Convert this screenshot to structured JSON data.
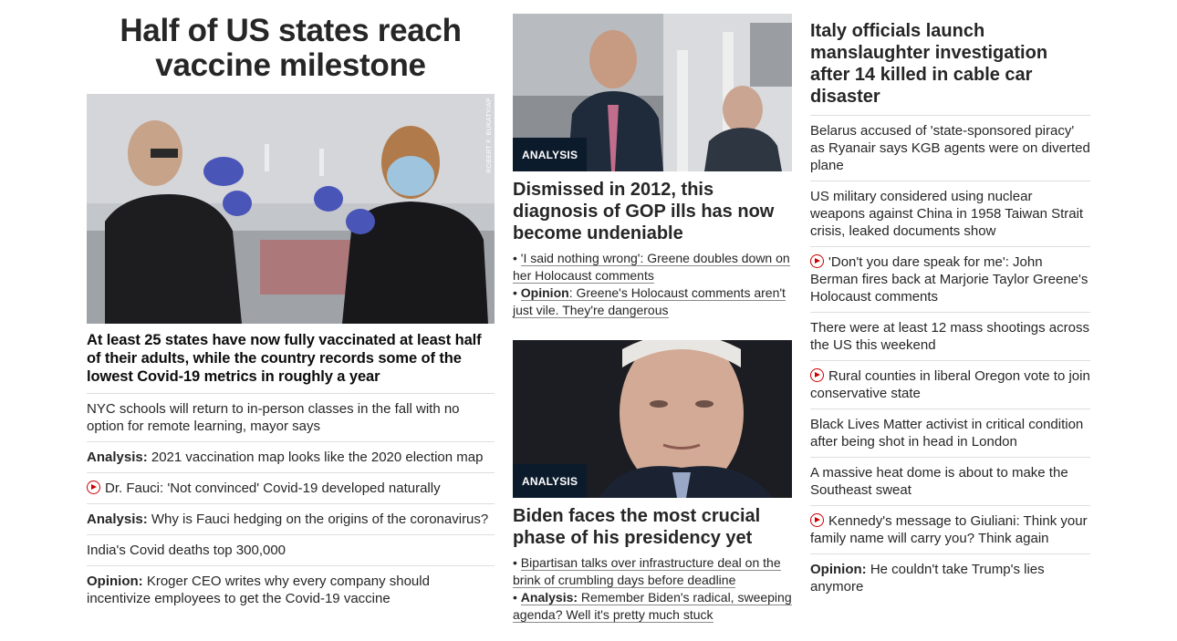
{
  "col1": {
    "headline": "Half of US states reach vaccine milestone",
    "photo_credit": "ROBERT F. BUKATY/AP",
    "sub_headline": "At least 25 states have now fully vaccinated at least half of their adults, while the country records some of the lowest Covid-19 metrics in roughly a year",
    "items": [
      {
        "prefix": "",
        "video": false,
        "text": "NYC schools will return to in-person classes in the fall with no option for remote learning, mayor says"
      },
      {
        "prefix": "Analysis:",
        "video": false,
        "text": "2021 vaccination map looks like the 2020 election map"
      },
      {
        "prefix": "",
        "video": true,
        "text": "Dr. Fauci: 'Not convinced' Covid-19 developed naturally"
      },
      {
        "prefix": "Analysis:",
        "video": false,
        "text": "Why is Fauci hedging on the origins of the coronavirus?"
      },
      {
        "prefix": "",
        "video": false,
        "text": "India's Covid deaths top 300,000"
      },
      {
        "prefix": "Opinion:",
        "video": false,
        "text": "Kroger CEO writes why every company should incentivize employees to get the Covid-19 vaccine"
      }
    ]
  },
  "col2": {
    "card1": {
      "badge": "ANALYSIS",
      "title": "Dismissed in 2012, this diagnosis of GOP ills has now become undeniable",
      "bullets": [
        {
          "prefix": "",
          "text": "'I said nothing wrong': Greene doubles down on her Holocaust comments"
        },
        {
          "prefix": "Opinion",
          "text": ": Greene's Holocaust comments aren't just vile. They're dangerous"
        }
      ]
    },
    "card2": {
      "badge": "ANALYSIS",
      "title": "Biden faces the most crucial phase of his presidency yet",
      "bullets": [
        {
          "prefix": "",
          "text": "Bipartisan talks over infrastructure deal on the brink of crumbling days before deadline"
        },
        {
          "prefix": "Analysis:",
          "text": " Remember Biden's radical, sweeping agenda? Well it's pretty much stuck"
        }
      ]
    }
  },
  "col3": {
    "headline": "Italy officials launch manslaughter investigation after 14 killed in cable car disaster",
    "items": [
      {
        "prefix": "",
        "video": false,
        "text": "Belarus accused of 'state-sponsored piracy' as Ryanair says KGB agents were on diverted plane"
      },
      {
        "prefix": "",
        "video": false,
        "text": "US military considered using nuclear weapons against China in 1958 Taiwan Strait crisis, leaked documents show"
      },
      {
        "prefix": "",
        "video": true,
        "text": "'Don't you dare speak for me': John Berman fires back at Marjorie Taylor Greene's Holocaust comments"
      },
      {
        "prefix": "",
        "video": false,
        "text": "There were at least 12 mass shootings across the US this weekend"
      },
      {
        "prefix": "",
        "video": true,
        "text": "Rural counties in liberal Oregon vote to join conservative state"
      },
      {
        "prefix": "",
        "video": false,
        "text": "Black Lives Matter activist in critical condition after being shot in head in London"
      },
      {
        "prefix": "",
        "video": false,
        "text": "A massive heat dome is about to make the Southeast sweat"
      },
      {
        "prefix": "",
        "video": true,
        "text": "Kennedy's message to Giuliani: Think your family name will carry you? Think again"
      },
      {
        "prefix": "Opinion:",
        "video": false,
        "text": "He couldn't take Trump's lies anymore"
      }
    ]
  },
  "colors": {
    "video_red": "#cc0000",
    "badge_bg": "#0c1b2b",
    "divider": "#dedede"
  }
}
